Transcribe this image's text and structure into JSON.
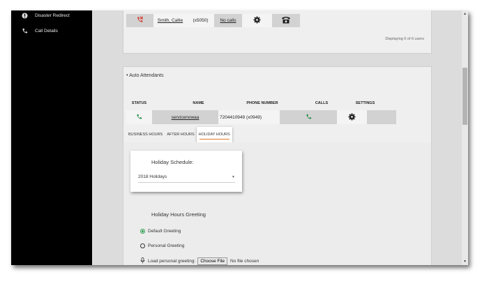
{
  "sidebar": {
    "items": [
      {
        "label": "Disaster Redirect",
        "icon": "info-circle-icon"
      },
      {
        "label": "Call Details",
        "icon": "phone-icon"
      }
    ]
  },
  "users": {
    "row": {
      "name": "Smith, Callie",
      "extension": "(x5050)",
      "calls": "No calls"
    },
    "displaying": "Displaying 6 of 6 users"
  },
  "auto_attendants": {
    "title": "Auto Attendants",
    "columns": [
      "STATUS",
      "NAME",
      "PHONE NUMBER",
      "CALLS",
      "SETTINGS"
    ],
    "row": {
      "name": "servicenowaa",
      "phone_number": "7204410949 (x0949)"
    },
    "tabs": [
      "BUSINESS HOURS",
      "AFTER HOURS",
      "HOLIDAY HOURS"
    ],
    "active_tab": "HOLIDAY HOURS"
  },
  "holiday": {
    "schedule_label": "Holiday Schedule:",
    "schedule_value": "2018 Holidays",
    "greeting_title": "Holiday Hours Greeting",
    "options": [
      {
        "label": "Default Greeting",
        "selected": true
      },
      {
        "label": "Personal Greeting",
        "selected": false
      }
    ],
    "load_label": "Load personal greeting:",
    "choose_button": "Choose File",
    "file_status": "No file chosen"
  },
  "colors": {
    "status_green": "#1f8a3e",
    "status_red": "#d23b2e",
    "tab_underline": "#e07a2e"
  }
}
